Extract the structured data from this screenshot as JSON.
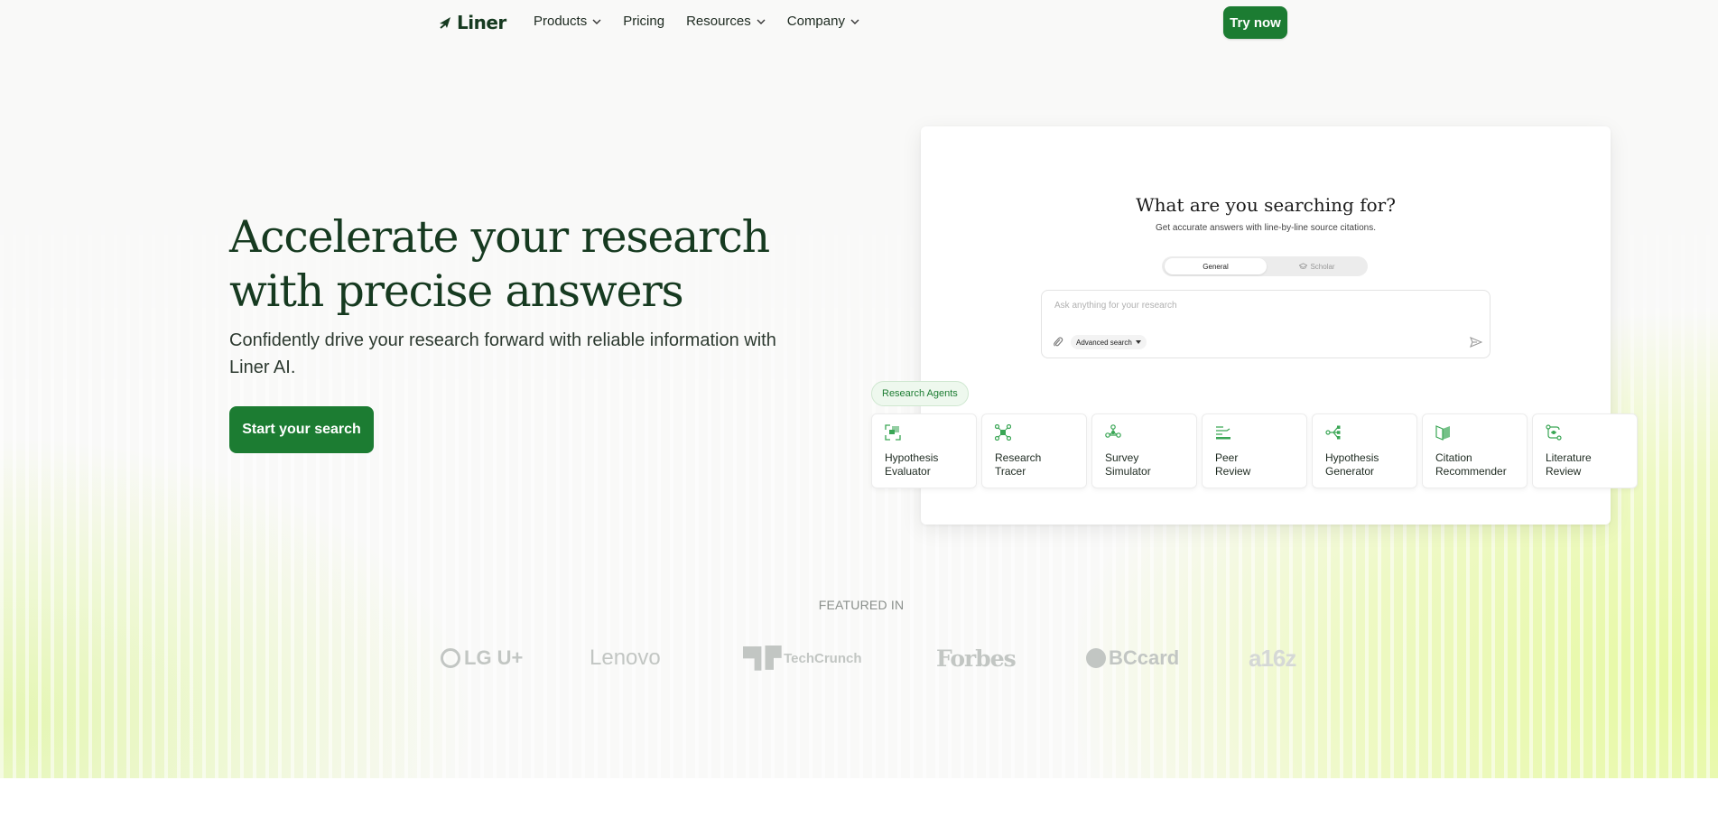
{
  "nav": {
    "logo_text": "Liner",
    "links": [
      {
        "label": "Products",
        "has_dropdown": true
      },
      {
        "label": "Pricing",
        "has_dropdown": false
      },
      {
        "label": "Resources",
        "has_dropdown": true
      },
      {
        "label": "Company",
        "has_dropdown": true
      }
    ],
    "cta_label": "Try now"
  },
  "hero": {
    "headline": "Accelerate your research with precise answers",
    "subtitle": "Confidently drive your research forward with reliable information with Liner AI.",
    "cta_label": "Start your search"
  },
  "demo": {
    "title": "What are you searching for?",
    "subtitle": "Get accurate answers with line-by-line source citations.",
    "modes": [
      {
        "label": "General",
        "active": true
      },
      {
        "label": "Scholar",
        "active": false
      }
    ],
    "search_placeholder": "Ask anything for your research",
    "advanced_label": "Advanced search",
    "agents_tag": "Research Agents",
    "agents": [
      {
        "label": "Hypothesis\nEvaluator",
        "icon": "expand-icon"
      },
      {
        "label": "Research\nTracer",
        "icon": "network-icon"
      },
      {
        "label": "Survey\nSimulator",
        "icon": "nodes-icon"
      },
      {
        "label": "Peer\nReview",
        "icon": "review-icon"
      },
      {
        "label": "Hypothesis\nGenerator",
        "icon": "branch-icon"
      },
      {
        "label": "Citation\nRecommender",
        "icon": "pages-icon"
      },
      {
        "label": "Literature\nReview",
        "icon": "flow-icon"
      }
    ]
  },
  "featured": {
    "label": "FEATURED IN",
    "logos": [
      "LG U+",
      "Lenovo",
      "TechCrunch",
      "Forbes",
      "BCcard",
      "a16z"
    ]
  },
  "colors": {
    "brand_green": "#1c7c32",
    "headline_green": "#163a20",
    "accent_lime": "#e6f9a0"
  }
}
